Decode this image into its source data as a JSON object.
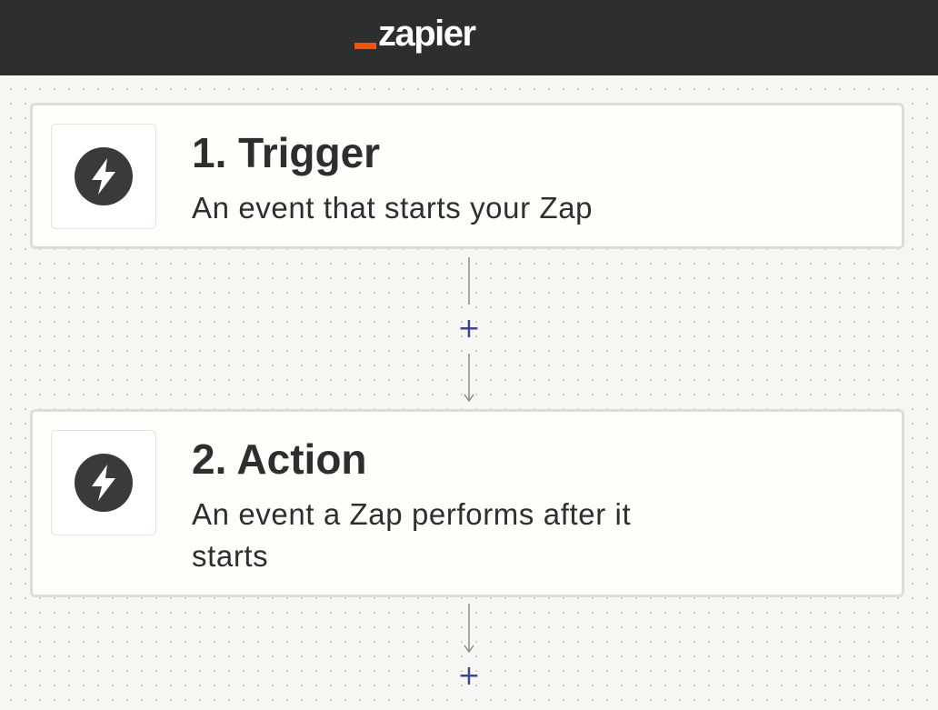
{
  "header": {
    "logo_text": "zapier",
    "brand_color": "#ff4f00"
  },
  "steps": [
    {
      "title": "1. Trigger",
      "description": "An event that starts your Zap",
      "icon": "lightning-bolt-icon"
    },
    {
      "title": "2. Action",
      "description": "An event a Zap performs after it starts",
      "icon": "lightning-bolt-icon"
    }
  ],
  "connectors": {
    "add_step_symbol": "+",
    "accent_color": "#3d4592"
  }
}
